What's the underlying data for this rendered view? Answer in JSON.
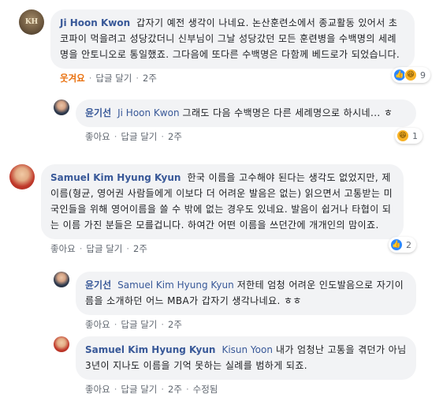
{
  "comments": [
    {
      "author": "Ji Hoon Kwon",
      "avatar_text": "KH",
      "text": "갑자기 예전 생각이 나네요. 논산훈련소에서 종교활동 있어서 초코파이 먹을려고 성당갔더니 신부님이 그날 성당갔던 모든 훈련병을 수백명의 세례명을 안토니오로 통일했죠. 그다음에 또다른 수백명은 다함께 베드로가 되었습니다.",
      "like_label": "웃겨요",
      "reply_label": "답글 달기",
      "time": "2주",
      "reactions": {
        "icons": [
          "like-icon",
          "wow-icon"
        ],
        "count": "9"
      }
    },
    {
      "author": "윤기선",
      "mention": "Ji Hoon Kwon",
      "text": "그래도 다음 수백명은 다른 세례명으로 하시네... ㅎ",
      "like_label": "좋아요",
      "reply_label": "답글 달기",
      "time": "2주",
      "reactions": {
        "icons": [
          "wow-icon"
        ],
        "count": "1"
      }
    },
    {
      "author": "Samuel Kim Hyung Kyun",
      "text": "한국 이름을 고수해야 된다는 생각도 없었지만, 제 이름(형균, 영어권 사람들에게 이보다 더 어려운 발음은 없는) 읽으면서 고통받는 미국인들을 위해 영어이름을 쓸 수 밖에 없는 경우도 있네요. 발음이 쉽거나 타협이 되는 이름 가진 분들은 모를겁니다. 하여간 어떤 이름을 쓰던간에 개개인의 맘이죠.",
      "like_label": "좋아요",
      "reply_label": "답글 달기",
      "time": "2주",
      "reactions": {
        "icons": [
          "like-icon"
        ],
        "count": "2"
      }
    },
    {
      "author": "윤기선",
      "mention": "Samuel Kim Hyung Kyun",
      "text": "저한테 엄청 어려운 인도발음으로 자기이름을 소개하던 어느 MBA가 갑자기 생각나네요. ㅎㅎ",
      "like_label": "좋아요",
      "reply_label": "답글 달기",
      "time": "2주"
    },
    {
      "author": "Samuel Kim Hyung Kyun",
      "mention": "Kisun Yoon",
      "text": "내가 엄청난 고통을 겪던가 아님 3년이 지나도 이름을 기억 못하는 실례를 범하게 되죠.",
      "like_label": "좋아요",
      "reply_label": "답글 달기",
      "time": "2주",
      "edited_label": "수정됨"
    }
  ],
  "colors": {
    "link": "#385898",
    "bubble": "#f2f3f5",
    "haha_label": "#e9710f",
    "meta": "#606770"
  }
}
